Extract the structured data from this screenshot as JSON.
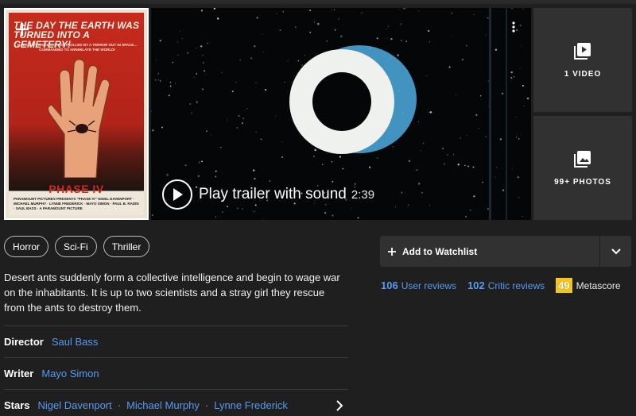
{
  "poster": {
    "headline": "THE DAY THE EARTH WAS TURNED INTO A CEMETERY!",
    "subline": "HAVOC! BY INVADERS CONTROLLED BY A TERROR OUT IN SPACE... COMMANDED TO ANNIHILATE THE WORLD!",
    "title": "PHASE IV",
    "credits": "PARAMOUNT PICTURES PRESENTS \"PHASE IV\" NIGEL DAVENPORT · MICHAEL MURPHY · LYNNE FREDERICK · MAYO SIMON · PAUL B. RADIN · SAUL BASS · A PARAMOUNT PICTURE"
  },
  "video": {
    "play_label": "Play trailer with sound",
    "duration": "2:39"
  },
  "tiles": {
    "videos_label": "1 VIDEO",
    "photos_label": "99+ PHOTOS"
  },
  "genres": [
    "Horror",
    "Sci-Fi",
    "Thriller"
  ],
  "plot": "Desert ants suddenly form a collective intelligence and begin to wage war on the inhabitants. It is up to two scientists and a stray girl they rescue from the ants to destroy them.",
  "credits": {
    "director_label": "Director",
    "director": "Saul Bass",
    "writer_label": "Writer",
    "writer": "Mayo Simon",
    "stars_label": "Stars",
    "stars": [
      "Nigel Davenport",
      "Michael Murphy",
      "Lynne Frederick"
    ],
    "separator": "·"
  },
  "watchlist": {
    "label": "Add to Watchlist"
  },
  "stats": {
    "user_reviews_count": "106",
    "user_reviews_label": "User reviews",
    "critic_reviews_count": "102",
    "critic_reviews_label": "Critic reviews",
    "metascore": "49",
    "metascore_label": "Metascore"
  },
  "colors": {
    "background": "#1f1f1f",
    "tile": "#313131",
    "link": "#5799ef",
    "metascore_badge": "#f5c518"
  },
  "icons": [
    "add-icon",
    "more-vertical-icon",
    "play-icon",
    "video-library-icon",
    "photo-library-icon",
    "chevron-down-icon",
    "chevron-right-icon"
  ]
}
